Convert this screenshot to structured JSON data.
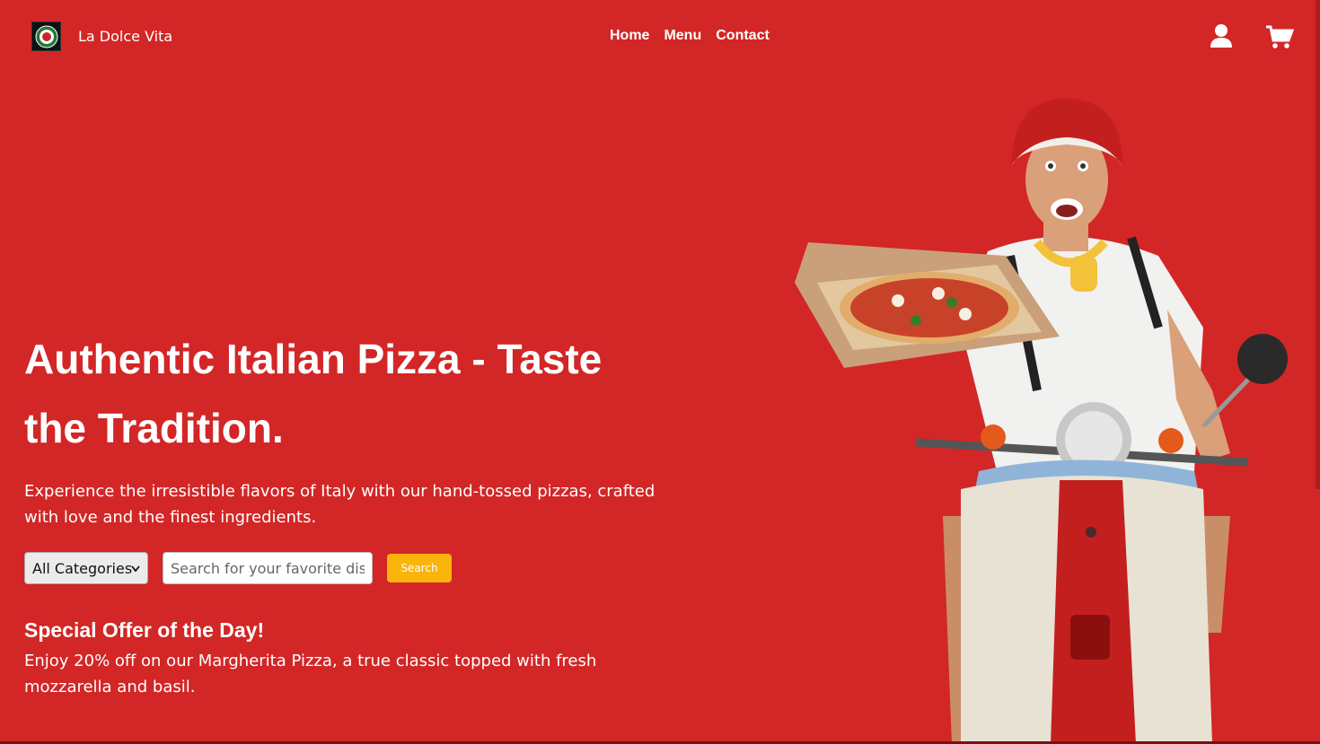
{
  "header": {
    "brand": "La Dolce Vita",
    "nav": [
      "Home",
      "Menu",
      "Contact"
    ],
    "icons": {
      "user": "user-icon",
      "cart": "cart-icon"
    }
  },
  "hero": {
    "title": "Authentic Italian Pizza - Taste the Tradition.",
    "subtitle": "Experience the irresistible flavors of Italy with our hand-tossed pizzas, crafted with love and the finest ingredients.",
    "image": "delivery-man-on-scooter-with-pizza"
  },
  "search": {
    "category_selected": "All Categories",
    "placeholder": "Search for your favorite dish...",
    "value": "",
    "button": "Search"
  },
  "offer": {
    "title": "Special Offer of the Day!",
    "text": "Enjoy 20% off on our Margherita Pizza, a true classic topped with fresh mozzarella and basil."
  },
  "colors": {
    "background": "#d32626",
    "accent": "#fbb40b",
    "text": "#ffffff"
  }
}
